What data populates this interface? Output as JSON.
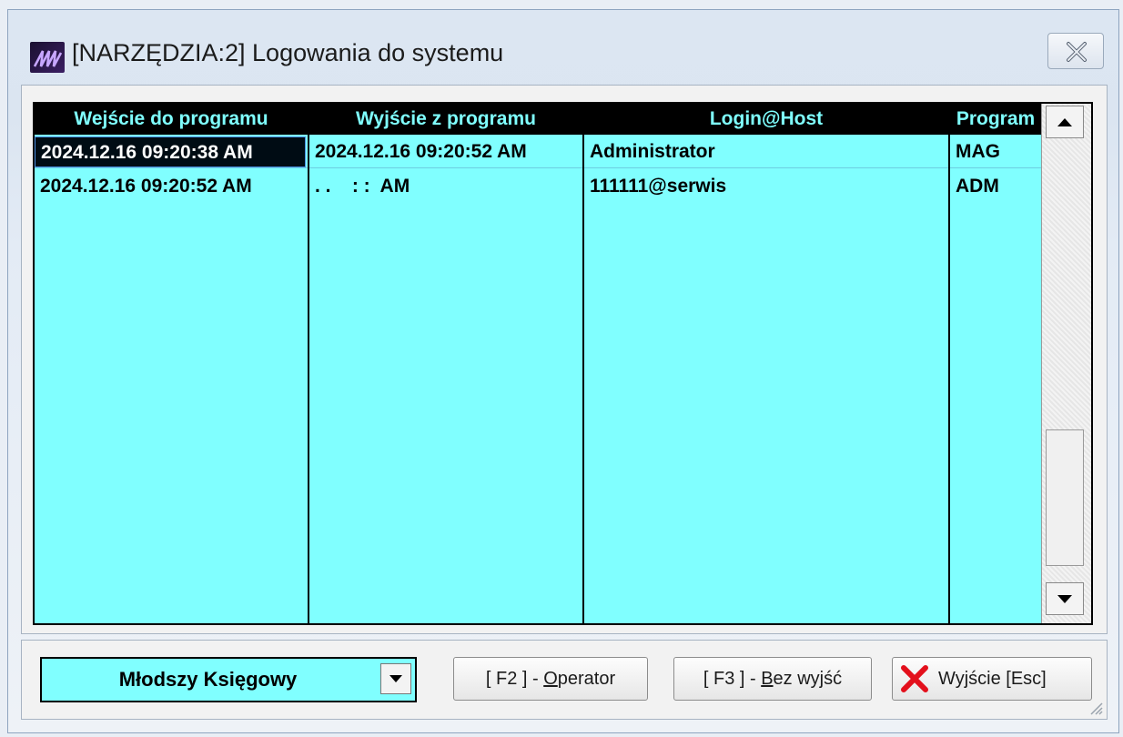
{
  "window": {
    "title": "[NARZĘDZIA:2]  Logowania do systemu",
    "close_label": "close"
  },
  "table": {
    "columns": [
      "Wejście do programu",
      "Wyjście z programu",
      "Login@Host",
      "Program"
    ],
    "rows": [
      [
        "2024.12.16 09:20:38 AM",
        "2024.12.16 09:20:52 AM",
        "Administrator",
        "MAG"
      ],
      [
        "2024.12.16 09:20:52 AM",
        ". .    : :  AM",
        "111111@serwis",
        "ADM"
      ]
    ]
  },
  "footer": {
    "role_select": "Młodszy Księgowy",
    "operator_button_prefix": "[ F2 ] - ",
    "operator_button_hotkey": "O",
    "operator_button_rest": "perator",
    "noexit_button_prefix": "[ F3 ] - ",
    "noexit_button_hotkey": "B",
    "noexit_button_rest": "ez wyjść",
    "exit_button": "Wyjście  [Esc]"
  },
  "colors": {
    "grid_bg": "#80ffff",
    "header_bg": "#000000",
    "header_fg": "#7fffff",
    "exit_icon": "#e3101c"
  },
  "icons": [
    "app-logo-icon",
    "close-icon",
    "scroll-up-icon",
    "scroll-down-icon",
    "dropdown-arrow-icon",
    "exit-x-icon",
    "resize-grip-icon"
  ]
}
